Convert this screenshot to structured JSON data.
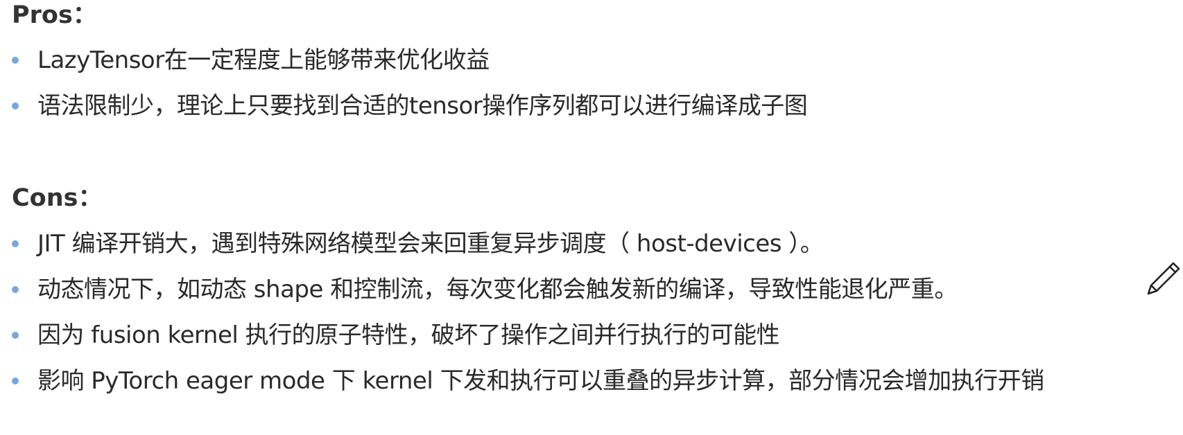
{
  "pros": {
    "heading": "Pros：",
    "items": [
      "LazyTensor在一定程度上能够带来优化收益",
      "语法限制少，理论上只要找到合适的tensor操作序列都可以进行编译成子图"
    ]
  },
  "cons": {
    "heading": "Cons：",
    "items": [
      "JIT 编译开销大，遇到特殊网络模型会来回重复异步调度（ host-devices ）。",
      "动态情况下，如动态 shape 和控制流，每次变化都会触发新的编译，导致性能退化严重。",
      "因为 fusion kernel 执行的原子特性，破坏了操作之间并行执行的可能性",
      "影响 PyTorch eager mode 下 kernel 下发和执行可以重叠的异步计算，部分情况会增加执行开销"
    ]
  },
  "icons": {
    "annotate": "pencil-icon"
  },
  "colors": {
    "bullet": "#74a8e0",
    "text": "#2a2a2a",
    "heading": "#333333"
  }
}
